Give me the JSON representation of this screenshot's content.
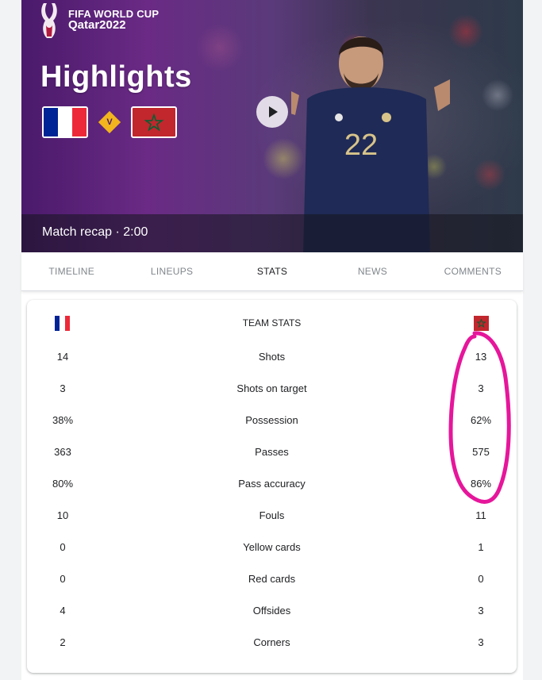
{
  "hero": {
    "logo_line1": "FIFA WORLD CUP",
    "logo_line2": "Qatar2022",
    "title": "Highlights",
    "vs": "V",
    "recap": "Match recap · 2:00",
    "jersey_number": "22",
    "home_flag": "france-flag",
    "away_flag": "morocco-flag",
    "play_icon": "play-icon"
  },
  "tabs": [
    {
      "label": "TIMELINE",
      "active": false
    },
    {
      "label": "LINEUPS",
      "active": false
    },
    {
      "label": "STATS",
      "active": true
    },
    {
      "label": "NEWS",
      "active": false
    },
    {
      "label": "COMMENTS",
      "active": false
    }
  ],
  "stats": {
    "title": "TEAM STATS",
    "rows": [
      {
        "label": "Shots",
        "home": "14",
        "away": "13"
      },
      {
        "label": "Shots on target",
        "home": "3",
        "away": "3"
      },
      {
        "label": "Possession",
        "home": "38%",
        "away": "62%"
      },
      {
        "label": "Passes",
        "home": "363",
        "away": "575"
      },
      {
        "label": "Pass accuracy",
        "home": "80%",
        "away": "86%"
      },
      {
        "label": "Fouls",
        "home": "10",
        "away": "11"
      },
      {
        "label": "Yellow cards",
        "home": "0",
        "away": "1"
      },
      {
        "label": "Red cards",
        "home": "0",
        "away": "0"
      },
      {
        "label": "Offsides",
        "home": "4",
        "away": "3"
      },
      {
        "label": "Corners",
        "home": "2",
        "away": "3"
      }
    ]
  },
  "colors": {
    "france_blue": "#002395",
    "france_white": "#ffffff",
    "france_red": "#ed2939",
    "morocco_red": "#c1272d",
    "morocco_green": "#006233",
    "annotation": "#e6169b",
    "jersey": "#1f2a56",
    "vs_badge": "#f2b51e"
  }
}
